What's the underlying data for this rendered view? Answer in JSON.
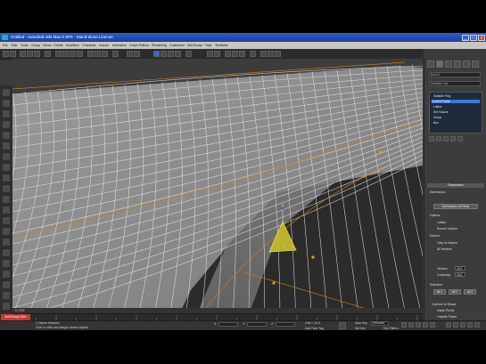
{
  "window": {
    "title": "Untitled   - Autodesk 3ds Max 8 SP3   - Stand-alone License",
    "buttons": {
      "minimize": "_",
      "maximize": "□",
      "close": "x"
    }
  },
  "menu": [
    "File",
    "Edit",
    "Tools",
    "Group",
    "Views",
    "Create",
    "Modifiers",
    "Character",
    "reactor",
    "Animation",
    "Graph Editors",
    "Rendering",
    "Customize",
    "MAXScript",
    "Help",
    "Tentacles"
  ],
  "viewport": {
    "label": "Perspective"
  },
  "command_panel": {
    "object_name": "Box01",
    "modifier_list": "Modifier List",
    "stack": [
      {
        "label": "Editable Poly",
        "selected": false
      },
      {
        "label": "Control Points",
        "selected": true
      },
      {
        "label": "Lattice",
        "selected": false
      },
      {
        "label": "Set Volume",
        "selected": false
      },
      {
        "label": "Group",
        "selected": false
      },
      {
        "label": "Box",
        "selected": false
      }
    ],
    "rollouts": {
      "parameters": "Parameters",
      "dimensions": "Dimensions",
      "dim_button": "Set Number of Points",
      "options": "Options",
      "opt_lattice": "Lattice",
      "opt_source": "Source Volume",
      "deform": "Deform",
      "deform_inside": "Only In Volume",
      "deform_all": "All Vertices",
      "tension_label": "Tension",
      "tension_value": "25.0",
      "continuity_label": "Continuity",
      "continuity_value": "25.0",
      "selection": "Selection",
      "sel_all": "All X",
      "sel_y": "All Y",
      "sel_z": "All Z",
      "conform": "Conform to Shape",
      "inside": "Inside Points",
      "outside": "Outside Points",
      "offset": "Offset"
    }
  },
  "timeline": {
    "frame_display": "0 / 100"
  },
  "status": {
    "maxscript": "MAXScript Mini",
    "selected": "1 Object Selected",
    "prompt": "Click or click-and-drag to select objects",
    "x_label": "X:",
    "y_label": "Y:",
    "z_label": "Z:",
    "grid": "Grid = 10.0",
    "auto_key": "Auto Key",
    "set_key": "Set Key",
    "key_filters": "Key Filters...",
    "selected_drop": "Selected",
    "add_time_tag": "Add Time Tag"
  }
}
